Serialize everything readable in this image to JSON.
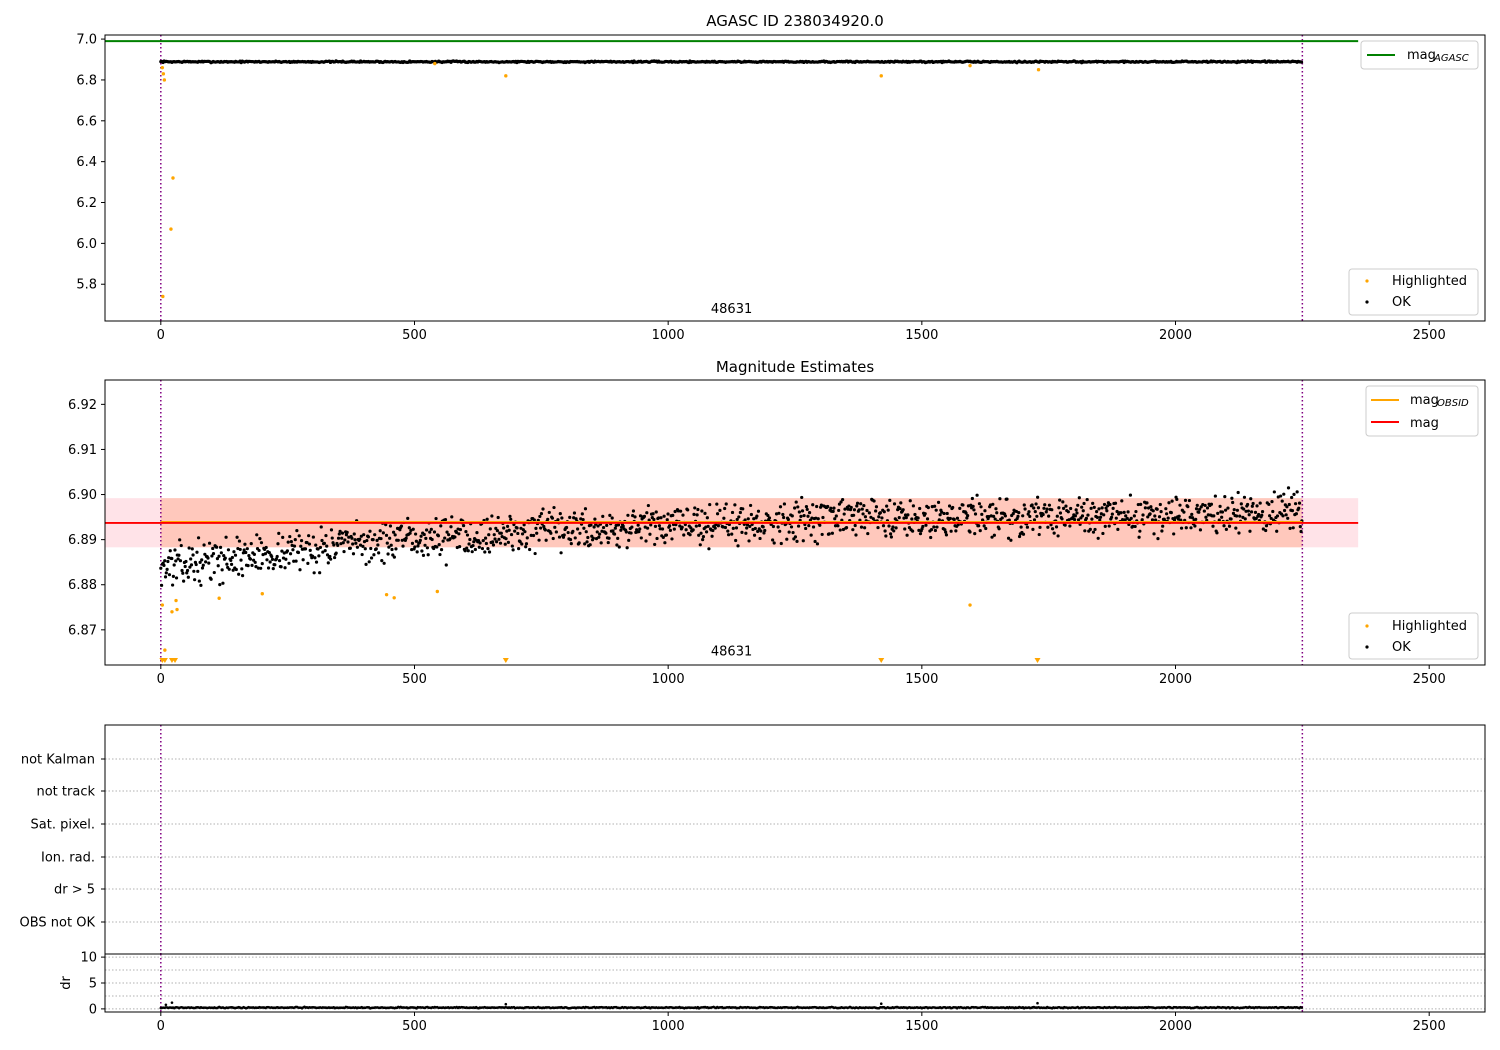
{
  "colors": {
    "agasc_line": "#008000",
    "highlighted": "#ffa500",
    "ok": "#000000",
    "mag_line": "#ff0000",
    "mag_obsid_line": "#ffa500",
    "band_outer": "#ffc0cb",
    "band_inner": "#ffa07a",
    "vline": "#800080",
    "grid": "#b0b0b0"
  },
  "chart_data": [
    {
      "type": "scatter",
      "title": "AGASC ID 238034920.0",
      "xlim": [
        -110,
        2610
      ],
      "ylim": [
        5.62,
        7.02
      ],
      "x_ticks": [
        0,
        500,
        1000,
        1500,
        2000,
        2500
      ],
      "y_ticks": [
        5.8,
        6.0,
        6.2,
        6.4,
        6.6,
        6.8,
        7.0
      ],
      "y_tick_labels": [
        "5.8",
        "6.0",
        "6.2",
        "6.4",
        "6.6",
        "6.8",
        "7.0"
      ],
      "obsid_vlines": [
        0,
        2250
      ],
      "obsid_label": {
        "x": 1125,
        "y": 5.66,
        "text": "48631"
      },
      "mag_agasc": {
        "value": 6.99,
        "x_range": [
          -110,
          2360
        ]
      },
      "ok_series": {
        "name": "OK",
        "x_range": [
          0,
          2250
        ],
        "mean": 6.889,
        "spread": 0.004
      },
      "highlighted_series": {
        "name": "Highlighted",
        "points": [
          [
            3,
            6.86
          ],
          [
            5,
            6.83
          ],
          [
            7,
            6.8
          ],
          [
            4,
            5.74
          ],
          [
            20,
            6.07
          ],
          [
            24,
            6.32
          ],
          [
            540,
            6.88
          ],
          [
            680,
            6.82
          ],
          [
            1420,
            6.82
          ],
          [
            1595,
            6.87
          ],
          [
            1730,
            6.85
          ]
        ]
      },
      "legend_top": {
        "position": "top-right",
        "entries": [
          "mag",
          "AGASC"
        ]
      },
      "legend_bottom": {
        "position": "bottom-right",
        "entries": [
          "Highlighted",
          "OK"
        ]
      }
    },
    {
      "type": "scatter",
      "title": "Magnitude Estimates",
      "xlim": [
        -110,
        2610
      ],
      "ylim": [
        6.8622,
        6.9254
      ],
      "x_ticks": [
        0,
        500,
        1000,
        1500,
        2000,
        2500
      ],
      "y_ticks": [
        6.87,
        6.88,
        6.89,
        6.9,
        6.91,
        6.92
      ],
      "y_tick_labels": [
        "6.87",
        "6.88",
        "6.89",
        "6.90",
        "6.91",
        "6.92"
      ],
      "obsid_vlines": [
        0,
        2250
      ],
      "obsid_label": {
        "x": 1125,
        "y": 6.8643,
        "text": "48631"
      },
      "mag": {
        "value": 6.8937,
        "x_range": [
          -110,
          2360
        ]
      },
      "mag_obsid": {
        "value": 6.8939,
        "x_range": [
          0,
          2250
        ]
      },
      "band_outer": {
        "low": 6.8883,
        "high": 6.8992,
        "x_range": [
          -110,
          2360
        ]
      },
      "band_inner": {
        "low": 6.8883,
        "high": 6.8992,
        "x_range": [
          0,
          2250
        ]
      },
      "ok_series": {
        "name": "OK",
        "x_range": [
          0,
          2250
        ],
        "trend": [
          [
            0,
            6.884
          ],
          [
            300,
            6.888
          ],
          [
            600,
            6.891
          ],
          [
            1000,
            6.893
          ],
          [
            1400,
            6.895
          ],
          [
            1800,
            6.895
          ],
          [
            2250,
            6.896
          ]
        ],
        "spread": 0.0048
      },
      "highlighted_series": {
        "name": "Highlighted",
        "points": [
          [
            3,
            6.8755
          ],
          [
            22,
            6.874
          ],
          [
            32,
            6.8745
          ],
          [
            30,
            6.8765
          ],
          [
            115,
            6.877
          ],
          [
            200,
            6.878
          ],
          [
            445,
            6.8778
          ],
          [
            460,
            6.8771
          ],
          [
            545,
            6.8785
          ],
          [
            1595,
            6.8755
          ],
          [
            8,
            6.8655
          ]
        ]
      },
      "lower_limit_markers": [
        3,
        8,
        22,
        28,
        680,
        1420,
        1728
      ],
      "legend_top": {
        "position": "top-right",
        "entries": [
          "mag",
          "OBSID",
          "mag"
        ]
      },
      "legend_bottom": {
        "position": "bottom-right",
        "entries": [
          "Highlighted",
          "OK"
        ]
      }
    },
    {
      "type": "table",
      "flags_panel": true,
      "xlim": [
        -110,
        2610
      ],
      "row_labels": [
        "not Kalman",
        "not track",
        "Sat. pixel.",
        "Ion. rad.",
        "dr > 5",
        "OBS not OK"
      ],
      "obsid_vlines": [
        0,
        2250
      ]
    },
    {
      "type": "scatter",
      "xlim": [
        -110,
        2610
      ],
      "ylim": [
        -0.6,
        10.6
      ],
      "x_ticks": [
        0,
        500,
        1000,
        1500,
        2000,
        2500
      ],
      "y_ticks": [
        0,
        5,
        10
      ],
      "y_tick_labels": [
        "0",
        "5",
        "10"
      ],
      "ylabel": "dr",
      "obsid_vlines": [
        0,
        2250
      ],
      "ok_series": {
        "x_range": [
          0,
          2250
        ],
        "mean": 0.25,
        "spread": 0.12
      },
      "spikes": [
        [
          10,
          0.8
        ],
        [
          22,
          1.2
        ],
        [
          680,
          0.9
        ],
        [
          1420,
          1.0
        ],
        [
          1728,
          1.1
        ]
      ]
    }
  ]
}
